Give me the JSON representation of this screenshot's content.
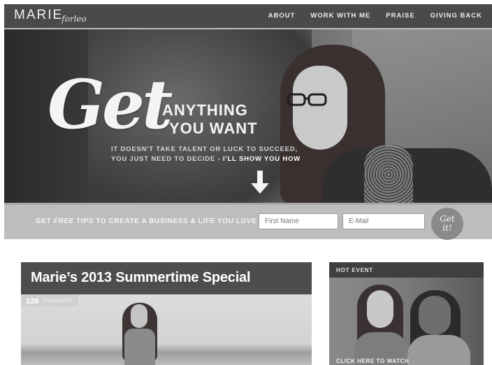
{
  "header": {
    "logo_main": "MARIE",
    "logo_script": "forleo",
    "nav": [
      "ABOUT",
      "WORK WITH ME",
      "PRAISE",
      "GIVING BACK"
    ]
  },
  "hero": {
    "script_word": "Get",
    "headline_line1": "ANYTHING",
    "headline_line2": "YOU WANT",
    "sub_line1": "IT DOESN'T TAKE TALENT OR LUCK TO SUCCEED,",
    "sub_line2_prefix": "YOU JUST NEED TO DECIDE - ",
    "sub_line2_strong": "I'LL SHOW YOU HOW",
    "arrow_icon": "arrow-down-icon"
  },
  "optin": {
    "text_prefix": "GET ",
    "text_emphasis": "FREE",
    "text_suffix": " TIPS TO CREATE A BUSINESS & LIFE YOU LOVE",
    "first_name_placeholder": "First Name",
    "email_placeholder": "E-Mail",
    "button_line1": "Get",
    "button_line2": "it!"
  },
  "post": {
    "title": "Marie’s 2013 Summertime Special",
    "comments_count": "128",
    "comments_label": "COMMENTS"
  },
  "event": {
    "label": "HOT EVENT",
    "cta": "CLICK HERE TO WATCH"
  },
  "colors": {
    "header_bg": "#4a4a4a",
    "optin_bg": "#bdbdbd",
    "post_header_bg": "#4d4d4d"
  }
}
